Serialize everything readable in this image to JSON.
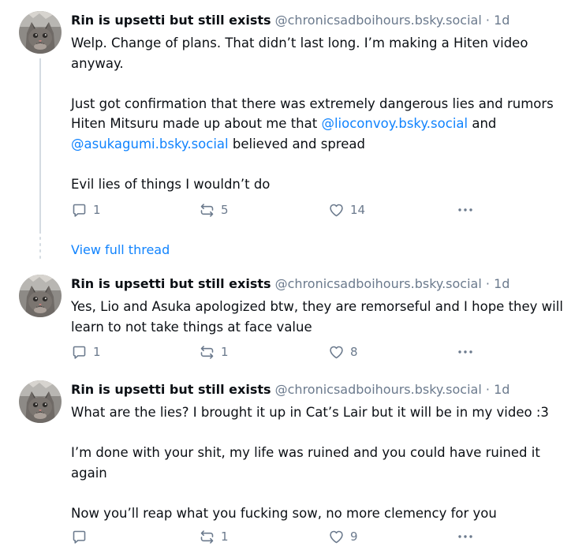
{
  "posts": [
    {
      "author": "Rin is upsetti but still exists",
      "handle": "@chronicsadboihours.bsky.social",
      "separator": "·",
      "time": "1d",
      "text_line_1": "Welp. Change of plans. That didn’t last long. I’m making a Hiten video anyway.",
      "text_p2_before": "Just got confirmation that there was extremely dangerous lies and rumors Hiten Mitsuru made up about me that ",
      "mention_1": "@lioconvoy.bsky.social",
      "text_p2_mid": " and ",
      "mention_2": "@asukagumi.bsky.social",
      "text_p2_after": " believed and spread",
      "text_p3": "Evil lies of things I wouldn’t do",
      "replies": "1",
      "reposts": "5",
      "likes": "14"
    },
    {
      "author": "Rin is upsetti but still exists",
      "handle": "@chronicsadboihours.bsky.social",
      "separator": "·",
      "time": "1d",
      "text_p1": "Yes, Lio and Asuka apologized btw, they are remorseful and I hope they will learn to not take things at face value",
      "replies": "1",
      "reposts": "1",
      "likes": "8"
    },
    {
      "author": "Rin is upsetti but still exists",
      "handle": "@chronicsadboihours.bsky.social",
      "separator": "·",
      "time": "1d",
      "text_p1": "What are the lies? I brought it up in Cat’s Lair but it will be in my video :3",
      "text_p2": "I’m done with your shit, my life was ruined and you could have ruined it again",
      "text_p3": "Now you’ll reap what you fucking sow, no more clemency for you",
      "replies": "",
      "reposts": "1",
      "likes": "9"
    }
  ],
  "thread": {
    "view_full_thread": "View full thread"
  },
  "icons": {
    "reply": "reply-icon",
    "repost": "repost-icon",
    "like": "heart-icon",
    "more": "more-dots-icon"
  },
  "colors": {
    "link": "#1083fe",
    "muted": "#6b7a8d",
    "text": "#0b0f14",
    "thread_line": "#d4dbe2"
  }
}
